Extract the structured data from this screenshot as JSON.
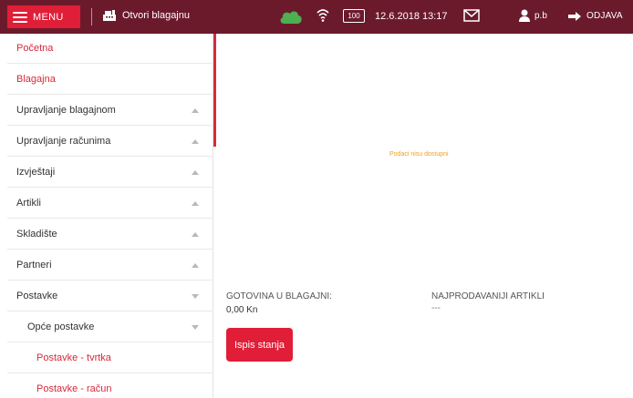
{
  "header": {
    "menu_label": "MENU",
    "register_label": "Otvori blagajnu",
    "battery_text": "100",
    "datetime": "12.6.2018 13:17",
    "user_name": "p.b",
    "logout_label": "ODJAVA"
  },
  "sidebar": {
    "items": [
      {
        "label": "Početna"
      },
      {
        "label": "Blagajna"
      },
      {
        "label": "Upravljanje blagajnom"
      },
      {
        "label": "Upravljanje računima"
      },
      {
        "label": "Izvještaji"
      },
      {
        "label": "Artikli"
      },
      {
        "label": "Skladište"
      },
      {
        "label": "Partneri"
      },
      {
        "label": "Postavke"
      },
      {
        "label": "Opće postavke"
      },
      {
        "label": "Postavke - tvrtka"
      },
      {
        "label": "Postavke - račun"
      }
    ]
  },
  "main": {
    "empty_message": "Podaci nisu dostupni",
    "cash_label": "GOTOVINA U BLAGAJNI:",
    "cash_value": "0,00 Kn",
    "top_items_label": "NAJPRODAVANIJI ARTIKLI",
    "top_items_value": "---",
    "print_button": "Ispis stanja"
  },
  "colors": {
    "header_bg": "#6b1a2c",
    "accent": "#e01e37",
    "active_text": "#d8283b",
    "cloud": "#4caf50",
    "empty_message": "#f0a020"
  }
}
